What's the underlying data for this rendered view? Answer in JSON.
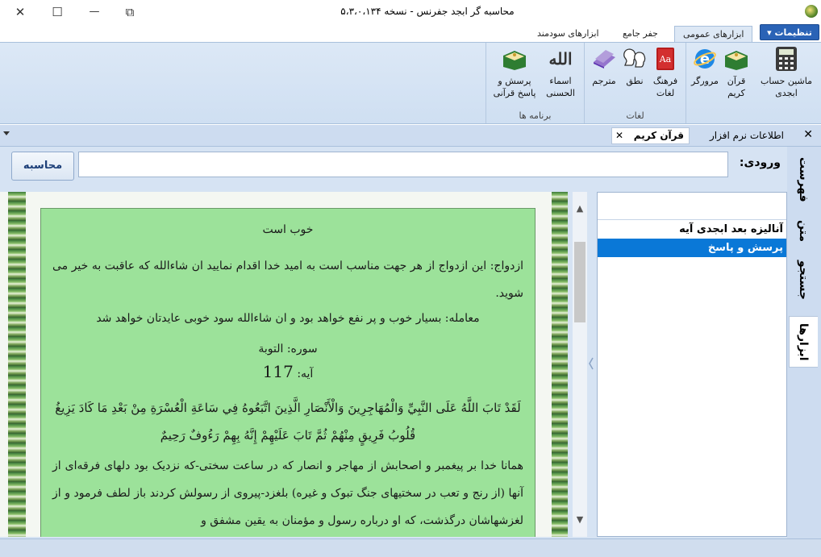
{
  "window": {
    "title": "محاسبه گر ابجد جفرنس - نسخه ۵،۳،۰،۱۳۴",
    "controls": {
      "close": "✕",
      "maximize": "☐",
      "minimize": "—",
      "restore": "⧉"
    }
  },
  "menu_tabs": {
    "settings": "تنظیمات",
    "tabs": [
      "ابزارهای عمومی",
      "جفر جامع",
      "ابزارهای سودمند"
    ]
  },
  "ribbon": {
    "group_main": {
      "calculator": "ماشین حساب ابجدی",
      "quran": "قرآن کریم",
      "browser": "مرورگر"
    },
    "group_lexicon": {
      "label": "لغات",
      "dictionary": "فرهنگ لغات",
      "pronunciation": "نطق",
      "translator": "مترجم"
    },
    "group_programs": {
      "label": "برنامه ها",
      "asma": "اسماء الحسنی",
      "qa": "پرسش و پاسخ قرآنی"
    }
  },
  "panel": {
    "doc_tab": "قرآن کریم",
    "doc_tab_close": "✕",
    "info_tab": "اطلاعات نرم افزار",
    "close": "✕"
  },
  "side_tabs": [
    "فهرست",
    "متن",
    "جستجو",
    "ابزارها"
  ],
  "input": {
    "label": "ورودی:",
    "value": "",
    "button": "محاسبه"
  },
  "tools_list": {
    "items": [
      "آنالیزه بعد ابجدی آیه",
      "پرسش و پاسخ"
    ],
    "selected_index": 1
  },
  "reading": {
    "heading": "خوب است",
    "marriage": "ازدواج: این ازدواج از هر جهت مناسب است به امید خدا اقدام نمایید ان شاءالله که عاقبت به خیر می شوید.",
    "trade": "معامله: بسیار خوب و پر نفع خواهد بود و ان شاءالله سود خوبی عایدتان خواهد شد",
    "surah": "سوره: التوبة",
    "ayah_label": "آیه:",
    "ayah_number": "117",
    "arabic": "لَقَدْ تَابَ اللَّهُ عَلَى النَّبِيِّ وَالْمُهَاجِرِينَ وَالْأَنْصَارِ الَّذِينَ اتَّبَعُوهُ فِي سَاعَةِ الْعُسْرَةِ مِنْ بَعْدِ مَا كَادَ يَزِيغُ قُلُوبُ فَرِيقٍ مِنْهُمْ ثُمَّ تَابَ عَلَيْهِمْ إِنَّهُ بِهِمْ رَءُوفٌ رَحِيمٌ",
    "translation": "همانا خدا بر پیغمبر و اصحابش از مهاجر و انصار که در ساعت سختی-که نزدیک بود دلهای فرقه‌ای از آنها (از رنج و تعب در سختیهای جنگ تبوک و غیره) بلغزد-پیروی از رسولش کردند باز لطف فرمود و از لغزشهاشان درگذشت، که او درباره رسول و مؤمنان به یقین مشفق و"
  },
  "colors": {
    "accent": "#2a63b6",
    "ribbon_bg": "#dce8f6",
    "page_bg": "#9ce29a",
    "selection": "#0a78d7"
  }
}
